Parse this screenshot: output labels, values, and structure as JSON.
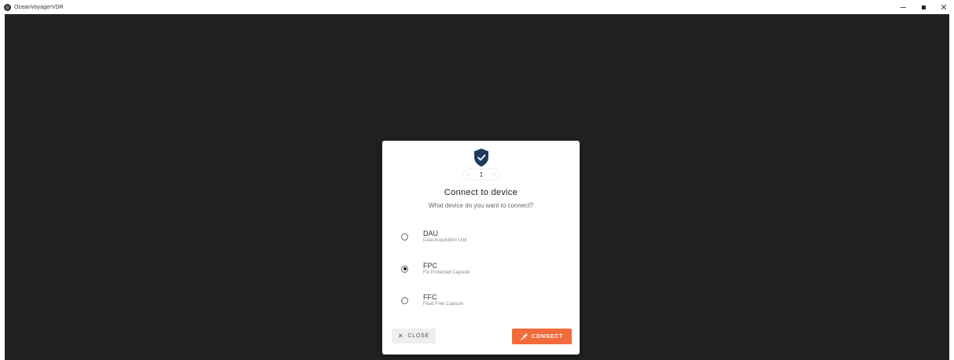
{
  "window": {
    "title": "OceanVoyagerVDR",
    "controls": {
      "minimize": "—",
      "maximize": "▣",
      "close": "✕"
    }
  },
  "dialog": {
    "title": "Connect to device",
    "subtitle": "What device do you want to connect?",
    "options": [
      {
        "name": "DAU",
        "description": "Data Acquisition Unit",
        "selected": false
      },
      {
        "name": "FPC",
        "description": "Fix Protected Capsule",
        "selected": true
      },
      {
        "name": "FFC",
        "description": "Float Free Capsule",
        "selected": false
      }
    ],
    "close_icon": "✕",
    "close_label": "CLOSE",
    "connect_label": "CONNECT",
    "connect_icon": "plug-icon",
    "accent_color": "#f26b3a",
    "shield_color": "#1f3a5f"
  }
}
